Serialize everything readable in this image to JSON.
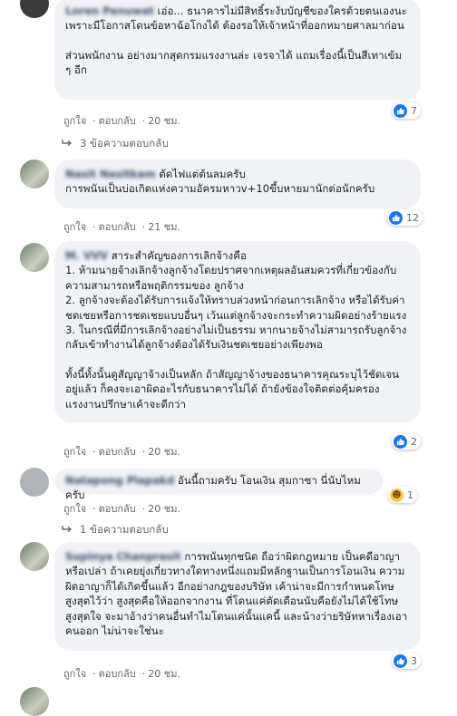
{
  "comments": [
    {
      "name": "Loren Panuwat",
      "text": "เอ่อ... ธนาคารไม่มีสิทธิ์ระงับบัญชีของใครด้วยตนเองนะ\nเพราะมีโอกาสโดนข้อหาฉ้อโกงได้ ต้องรอให้เจ้าหน้าที่ออกหมายศาลมาก่อน",
      "text2": "ส่วนพนักงาน อย่างมากสุดกรมแรงงานล่ะ เจรจาได้ แถมเรื่องนี้เป็นสีเทาเข้ม ๆ อีก",
      "like": "ถูกใจ",
      "reply": "ตอบกลับ",
      "time": "20 ชม.",
      "reactions": "7",
      "replies": "3 ข้อความตอบกลับ"
    },
    {
      "name": "Nasit Nasitkam",
      "text": "ตัดไฟแต่ต้นลมครับ\nการพนันเป็นบ่อเกิดแห่งความอัครมหาวv+10ขึ้บหายมานักต่อนักครับ",
      "like": "ถูกใจ",
      "reply": "ตอบกลับ",
      "time": "21 ชม.",
      "reactions": "12"
    },
    {
      "name": "M. VVV",
      "text": "สาระสำคัญของการเลิกจ้างคือ\n1. ห้ามนายจ้างเลิกจ้างลูกจ้างโดยปราศจากเหตุผลอันสมควรที่เกี่ยวข้องกับความสามารถหรือพฤติกรรมของ ลูกจ้าง\n2. ลูกจ้างจะต้องได้รับการแจ้งให้ทราบล่วงหน้าก่อนการเลิกจ้าง หรือได้รับค่าชดเชยหรือการชดเชยแบบอื่นๆ เว้นแต่ลูกจ้างจะกระทำความผิดอย่างร้ายแรง\n3. ในกรณีที่มีการเลิกจ้างอย่างไม่เป็นธรรม หากนายจ้างไม่สามารถรับลูกจ้างกลับเข้าทำงานได้ลูกจ้างต้องได้รับเงินชดเชยอย่างเพียงพอ",
      "text2": "ทั้งนี้ทั้งนั้นดูสัญญาจ้างเป็นหลัก ถ้าสัญญาจ้างของธนาคารคุณระบุไว้ชัดเจนอยู่แล้ว ก็คงจะเอาผิดอะไรกับธนาคารไม่ได้ ถ้ายังข้องใจติดต่อคุ้มครองแรงงานปรึกษาเค้าจะดีกว่า",
      "like": "ถูกใจ",
      "reply": "ตอบกลับ",
      "time": "20 ชม.",
      "reactions": "2"
    },
    {
      "name": "Natapong Plapakd",
      "text": "อันนี้ถามครับ โอนเงิน สุมกาซา นี่นับไหม ครับ",
      "like": "ถูกใจ",
      "reply": "ตอบกลับ",
      "time": "20 ชม.",
      "reactions": "1",
      "replies": "1 ข้อความตอบกลับ"
    },
    {
      "name": "Supinya Chanprasit",
      "text": "การพนันทุกชนิด ถือว่าผิดกฎหมาย เป็นคดีอาญาหรือเปล่า ถ้าเคยยุ่งเกี่ยวทางใดทางหนึ่งแถมมีหลักฐานเป็นการโอนเงิน ความผิดอาญาก็ได้เกิดขึ้นแล้ว อีกอย่างกฎของบริษัท เค้าน่าจะมีการกำหนดโทษสูงสุดไว้ว่า สูงสุดคือให้ออกจากงาน ที่โดนแค่ตัดเดือนนับคือยังไม่ได้ใช้โทษสูงสุดใจ จะมาอ้างว่าคนอื่นทำไมโดนแค่นั้นแคนี้ และน้างว่ายริษัทหาเรื่องเอาคนออก ไม่น่าจะใช่นะ",
      "like": "ถูกใจ",
      "reply": "ตอบกลับ",
      "time": "20 ชม.",
      "reactions": "3"
    }
  ]
}
